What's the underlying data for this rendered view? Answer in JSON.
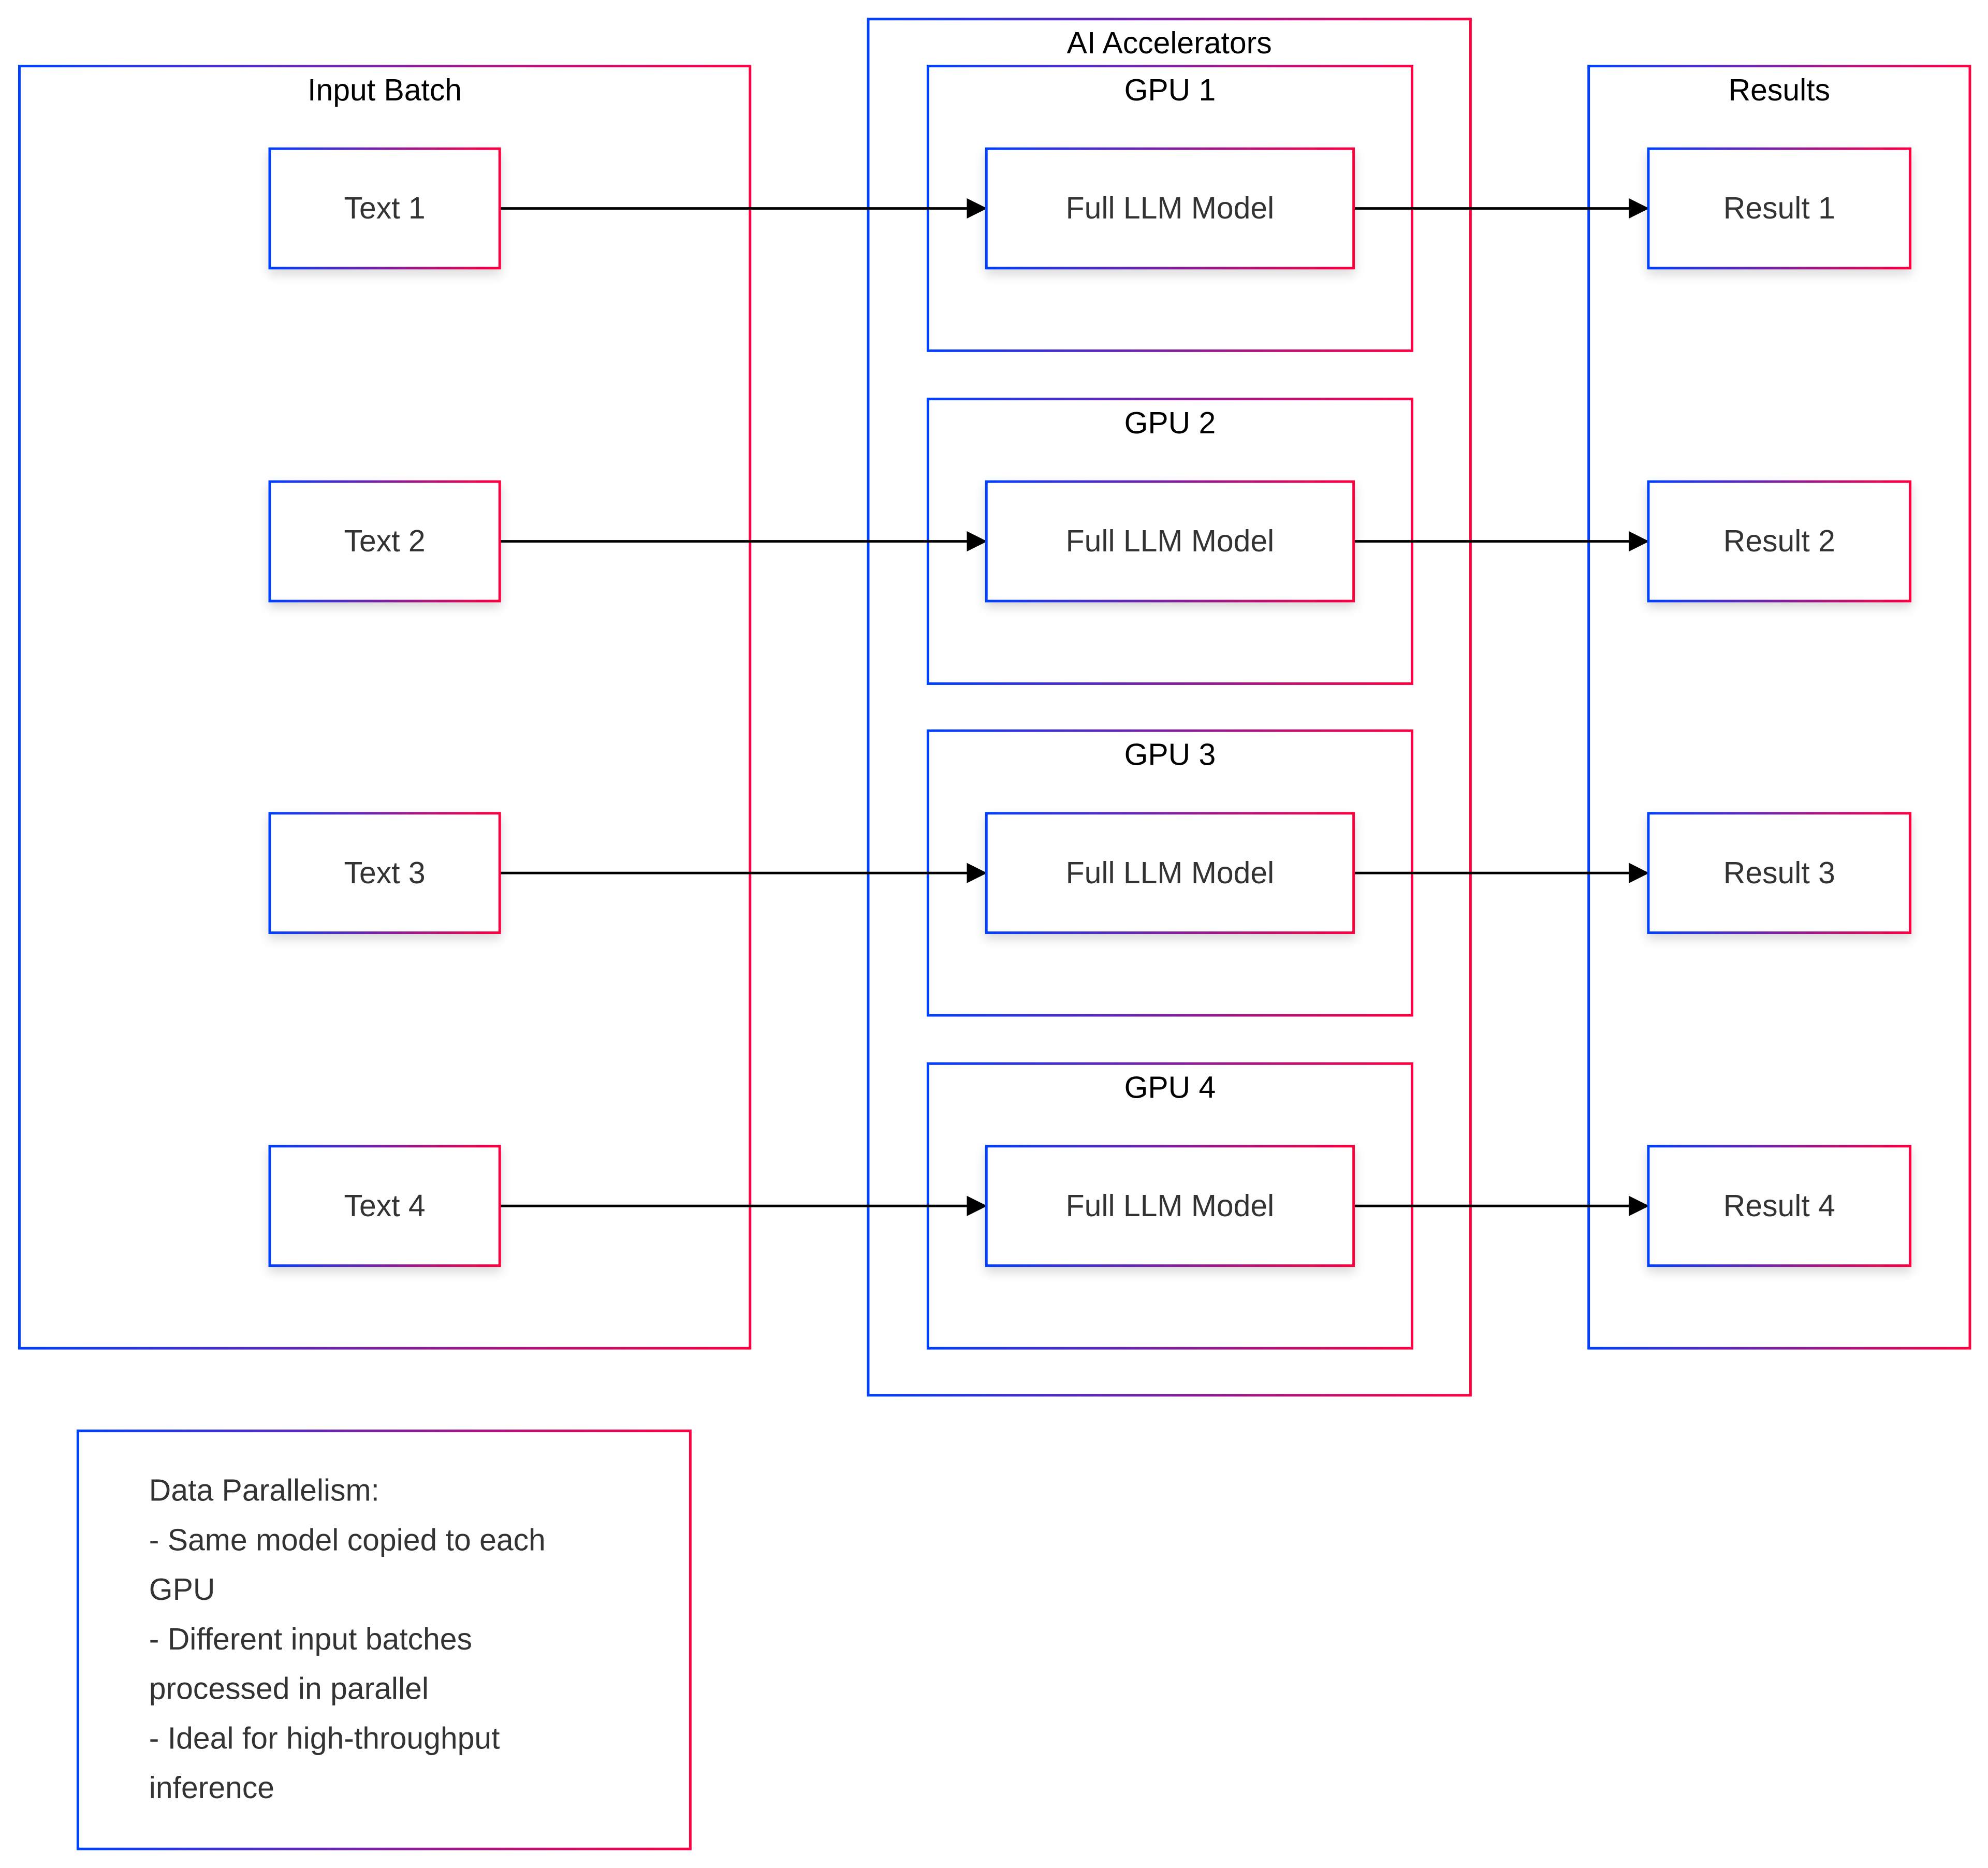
{
  "colors": {
    "gradient_start": "#0040ff",
    "gradient_end": "#ff0040",
    "edge": "#000000",
    "node_fill": "#ffffff"
  },
  "clusters": {
    "input": {
      "label": "Input Batch",
      "nodes": [
        "Text 1",
        "Text 2",
        "Text 3",
        "Text 4"
      ]
    },
    "accelerators": {
      "label": "AI Accelerators",
      "gpus": [
        {
          "label": "GPU 1",
          "model": "Full LLM Model"
        },
        {
          "label": "GPU 2",
          "model": "Full LLM Model"
        },
        {
          "label": "GPU 3",
          "model": "Full LLM Model"
        },
        {
          "label": "GPU 4",
          "model": "Full LLM Model"
        }
      ]
    },
    "results": {
      "label": "Results",
      "nodes": [
        "Result 1",
        "Result 2",
        "Result 3",
        "Result 4"
      ]
    }
  },
  "note": {
    "lines": [
      "Data Parallelism:",
      "- Same model copied to each",
      "GPU",
      "- Different input batches",
      "processed in parallel",
      "- Ideal for high-throughput",
      "inference"
    ]
  }
}
